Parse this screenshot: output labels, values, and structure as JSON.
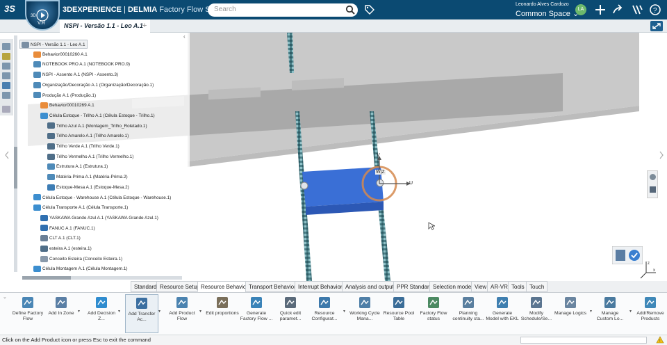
{
  "topbar": {
    "logo": "3S",
    "brand": "3DEXPERIENCE",
    "separator": " | ",
    "company": "DELMIA",
    "app_name": "Factory Flow Simulat...",
    "search_placeholder": "Search",
    "user_name": "Leonardo Alves Cardozo",
    "space": "Common Space",
    "avatar_initials": "LA",
    "compass_label": "V.R",
    "compass_3d": "3D",
    "accent_color": "#0b4a72"
  },
  "tab": {
    "title": "NSPI - Versão 1.1 - Leo A.1",
    "plus": "+"
  },
  "tree": {
    "items": [
      {
        "label": "NSPI - Versão 1.1 - Leo A.1",
        "icon": "product-root-icon"
      },
      {
        "label": "Behavior00010260 A.1",
        "icon": "behavior-icon"
      },
      {
        "label": "NOTEBOOK PRO A.1 (NOTEBOOK PRO.9)",
        "icon": "product-icon"
      },
      {
        "label": "NSPI - Assento A.1 (NSPI - Assento.3)",
        "icon": "product-icon"
      },
      {
        "label": "Organização/Decoração A.1 (Organização/Decoração.1)",
        "icon": "product-icon"
      },
      {
        "label": "Produção A.1 (Produção.1)",
        "icon": "product-icon"
      },
      {
        "label": "Behavior00010269 A.1",
        "icon": "behavior-icon"
      },
      {
        "label": "Célula Estoque - Trilho A.1 (Célula Estoque - Trilho.1)",
        "icon": "cell-icon"
      },
      {
        "label": "Trilho Azul A.1 (Montagem_Trilho_Roletado.1)",
        "icon": "conveyor-icon"
      },
      {
        "label": "Trilho Amarelo A.1 (Trilho Amarelo.1)",
        "icon": "conveyor-icon"
      },
      {
        "label": "Trilho Verde A.1 (Trilho Verde.1)",
        "icon": "conveyor-icon"
      },
      {
        "label": "Trilho Vermelho A.1 (Trilho Vermelho.1)",
        "icon": "conveyor-icon"
      },
      {
        "label": "Estrutura A.1 (Estrutura.1)",
        "icon": "product-icon"
      },
      {
        "label": "Matéria-Prima A.1 (Matéria-Prima.2)",
        "icon": "product-icon"
      },
      {
        "label": "Estoque-Mesa A.1 (Estoque-Mesa.2)",
        "icon": "storage-icon"
      },
      {
        "label": "Célula Estoque - Warehouse A.1 (Célula Estoque - Warehouse.1)",
        "icon": "cell-icon"
      },
      {
        "label": "Célula Transporte A.1 (Célula Transporte.1)",
        "icon": "cell-icon"
      },
      {
        "label": "YASKAWA Grande Azul A.1 (YASKAWA Grande Azul.1)",
        "icon": "robot-icon"
      },
      {
        "label": "FANUC A.1 (FANUC.1)",
        "icon": "robot-icon"
      },
      {
        "label": "CLT A.1 (CLT.1)",
        "icon": "worker-icon"
      },
      {
        "label": "esteira A.1 (esteira.1)",
        "icon": "conveyor-icon"
      },
      {
        "label": "Conceito Esteira (Conceito Esteira.1)",
        "icon": "concept-icon"
      },
      {
        "label": "Célula Montagem A.1 (Célula Montagem.1)",
        "icon": "cell-icon"
      }
    ]
  },
  "viewport": {
    "axis_u": "U",
    "axis_v": "V",
    "axis_wz": "W|Z",
    "box_color": "#3a6fd6",
    "floor_color": "#c9c9c9"
  },
  "command_tabs": [
    {
      "label": "Standard"
    },
    {
      "label": "Resource Setup"
    },
    {
      "label": "Resource Behavior",
      "active": true
    },
    {
      "label": "Transport Behavior"
    },
    {
      "label": "Interrupt Behavior"
    },
    {
      "label": "Analysis and output"
    },
    {
      "label": "PPR Standard"
    },
    {
      "label": "Selection mode"
    },
    {
      "label": "View"
    },
    {
      "label": "AR-VR"
    },
    {
      "label": "Tools"
    },
    {
      "label": "Touch"
    }
  ],
  "commands": [
    {
      "label": "Define Factory Flow",
      "icon": "define-flow-icon"
    },
    {
      "label": "Add In Zone",
      "icon": "in-zone-icon"
    },
    {
      "label": "Add Decision Z...",
      "icon": "decision-icon"
    },
    {
      "label": "Add Transfer Ac...",
      "icon": "transfer-icon"
    },
    {
      "label": "Add Product Flow",
      "icon": "product-flow-icon"
    },
    {
      "label": "Edit proportions",
      "icon": "proportions-icon"
    },
    {
      "label": "Generate Factory Flow ...",
      "icon": "generate-flow-icon"
    },
    {
      "label": "Quick edit paramet...",
      "icon": "quick-edit-icon"
    },
    {
      "label": "Resource Configurat...",
      "icon": "resource-config-icon"
    },
    {
      "label": "Working Cycle Mana...",
      "icon": "working-cycle-icon"
    },
    {
      "label": "Resource Pool Table",
      "icon": "pool-table-icon"
    },
    {
      "label": "Factory Flow status",
      "icon": "flow-status-icon"
    },
    {
      "label": "Planning continuity sta...",
      "icon": "planning-icon"
    },
    {
      "label": "Generate Model with EKL",
      "icon": "ekl-icon"
    },
    {
      "label": "Modify Schedule/Se...",
      "icon": "schedule-icon"
    },
    {
      "label": "Manage Logics",
      "icon": "logics-icon"
    },
    {
      "label": "Manage Custom Lo...",
      "icon": "custom-logic-icon"
    },
    {
      "label": "Add/Remove Products",
      "icon": "add-remove-icon"
    }
  ],
  "status": {
    "message": "Click on the Add Product icon or press Esc to exit the command"
  }
}
